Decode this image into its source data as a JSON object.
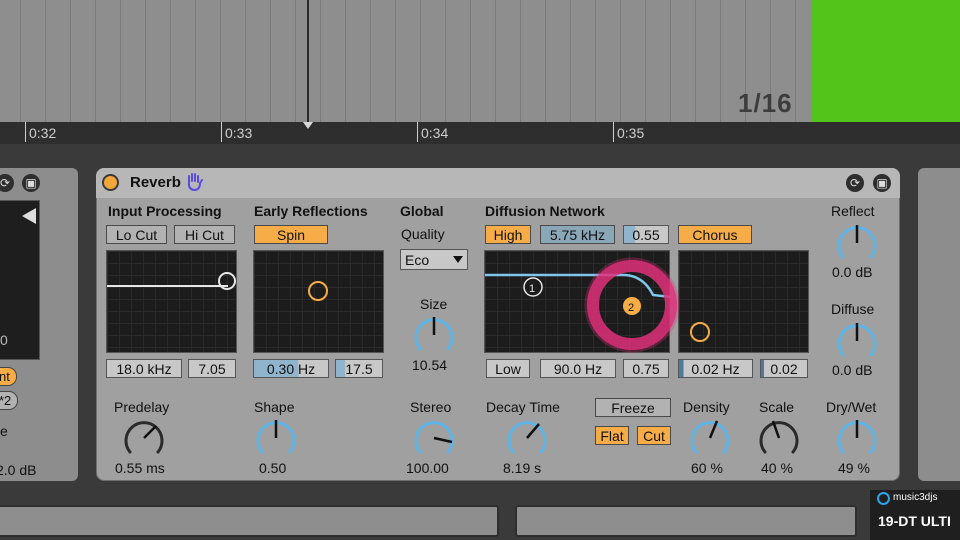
{
  "arrangement": {
    "bar_counter": "1/16",
    "timeline_labels": [
      "0:32",
      "0:33",
      "0:34",
      "0:35"
    ]
  },
  "left_device": {
    "buttons": [
      "nt",
      "*2"
    ],
    "value_partial": "2.0 dB",
    "label_partial": "e",
    "screen_digit": "0"
  },
  "reverb": {
    "title": "Reverb",
    "sections": {
      "input_processing": "Input Processing",
      "early_reflections": "Early Reflections",
      "global": "Global",
      "diffusion_network": "Diffusion Network"
    },
    "input": {
      "lo_cut": "Lo Cut",
      "hi_cut": "Hi Cut",
      "freq": "18.0 kHz",
      "q": "7.05"
    },
    "early": {
      "spin": "Spin",
      "rate": "0.30 Hz",
      "amount": "17.5"
    },
    "global": {
      "quality_label": "Quality",
      "quality_value": "Eco",
      "size_label": "Size",
      "size_value": "10.54"
    },
    "diffusion": {
      "high": "High",
      "high_freq": "5.75 kHz",
      "high_q": "0.55",
      "chorus": "Chorus",
      "low": "Low",
      "low_freq": "90.0 Hz",
      "low_q": "0.75",
      "chorus_rate": "0.02 Hz",
      "chorus_amount": "0.02",
      "point1": "1",
      "point2": "2"
    },
    "reflect": {
      "label": "Reflect",
      "value": "0.0 dB"
    },
    "diffuse": {
      "label": "Diffuse",
      "value": "0.0 dB"
    },
    "predelay": {
      "label": "Predelay",
      "value": "0.55 ms"
    },
    "shape": {
      "label": "Shape",
      "value": "0.50"
    },
    "stereo": {
      "label": "Stereo",
      "value": "100.00"
    },
    "decay": {
      "label": "Decay Time",
      "value": "8.19 s"
    },
    "freeze": {
      "label": "Freeze",
      "flat": "Flat",
      "cut": "Cut"
    },
    "density": {
      "label": "Density",
      "value": "60 %"
    },
    "scale": {
      "label": "Scale",
      "value": "40 %"
    },
    "drywet": {
      "label": "Dry/Wet",
      "value": "49 %"
    }
  },
  "branding": {
    "logo_small": "music3djs",
    "track_name": "19-DT ULTI"
  },
  "colors": {
    "accent_orange": "#f7ad47",
    "clip_green": "#52c41a",
    "highlight_pink": "#e0307a",
    "knob_blue": "#5fb4e6"
  }
}
